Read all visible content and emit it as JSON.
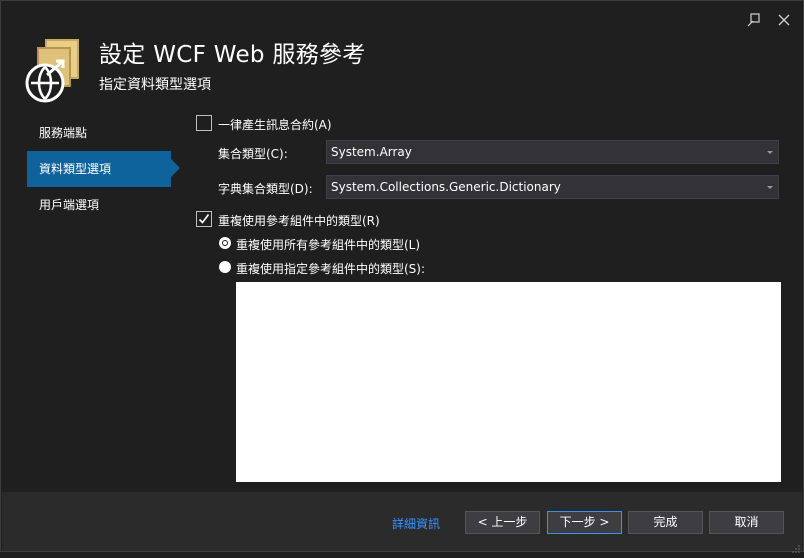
{
  "window": {
    "title": "設定 WCF Web 服務參考",
    "subtitle": "指定資料類型選項"
  },
  "nav": {
    "items": [
      {
        "label": "服務端點"
      },
      {
        "label": "資料類型選項"
      },
      {
        "label": "用戶端選項"
      }
    ],
    "selected": "資料類型選項"
  },
  "options": {
    "always_generate_label": "一律產生訊息合約(A)",
    "always_generate_checked": false,
    "collection_type_label": "集合類型(C):",
    "collection_type_value": "System.Array",
    "dictionary_type_label": "字典集合類型(D):",
    "dictionary_type_value": "System.Collections.Generic.Dictionary",
    "reuse_types_label": "重複使用參考組件中的類型(R)",
    "reuse_types_checked": true,
    "reuse_all_label": "重複使用所有參考組件中的類型(L)",
    "reuse_specified_label": "重複使用指定參考組件中的類型(S):",
    "reuse_mode": "all",
    "assemblies": []
  },
  "footer": {
    "more_info": "詳細資訊",
    "back": "< 上一步",
    "next": "下一步 >",
    "finish": "完成",
    "cancel": "取消"
  },
  "icons": {
    "restore": "restore-pin-icon",
    "close": "close-icon",
    "header": "wcf-service-reference-icon"
  },
  "colors": {
    "accent": "#0e639c",
    "link": "#3794ff",
    "background": "#1f1f1f",
    "footer": "#2b2b2b"
  }
}
